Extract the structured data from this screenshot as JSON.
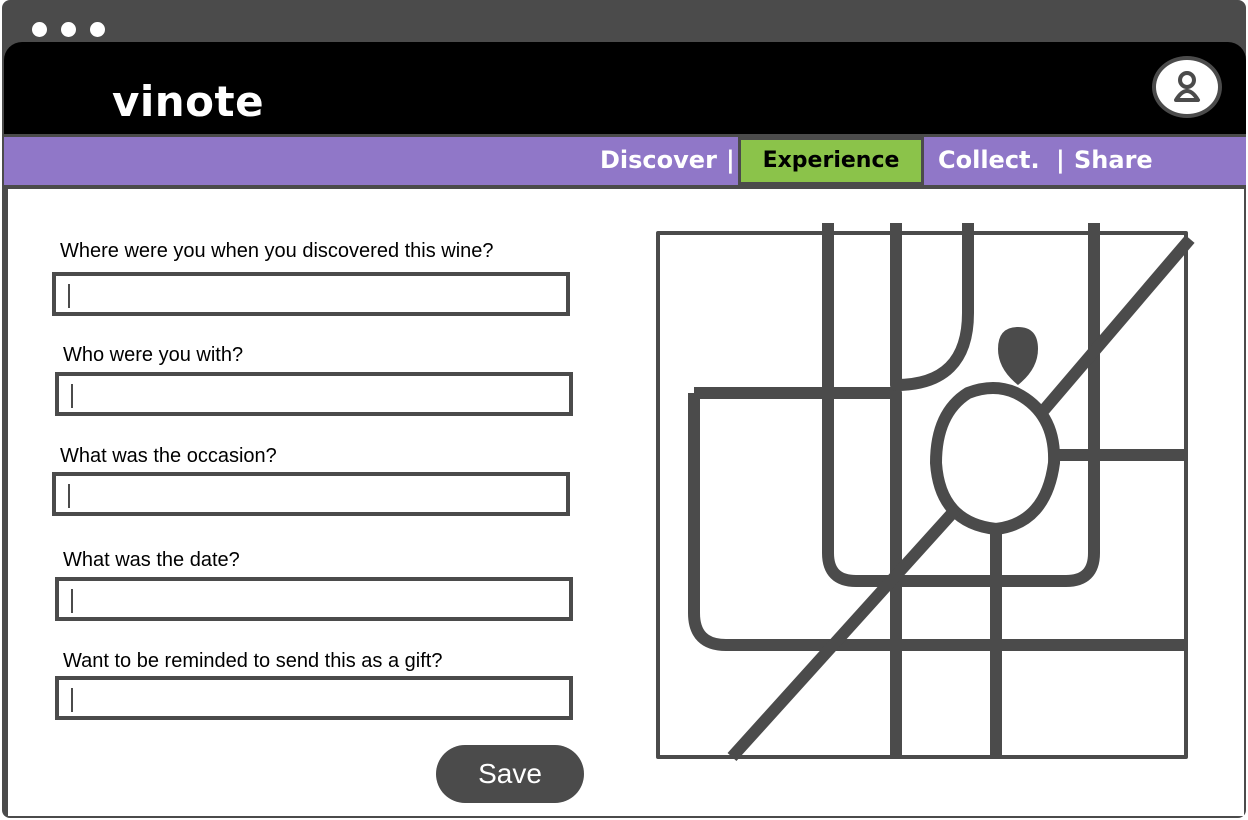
{
  "app": {
    "logo": "vinote"
  },
  "nav": {
    "items": [
      {
        "label": "Discover",
        "sep": "|"
      },
      {
        "label": "Experience",
        "active": true
      },
      {
        "label": "Collect.",
        "sep": "|"
      },
      {
        "label": "Share"
      }
    ]
  },
  "form": {
    "questions": [
      {
        "label": "Where were you when you discovered this wine?",
        "value": ""
      },
      {
        "label": "Who were you with?",
        "value": ""
      },
      {
        "label": "What was the occasion?",
        "value": ""
      },
      {
        "label": "What was the date?",
        "value": ""
      },
      {
        "label": "Want to be reminded to send this as a gift?",
        "value": ""
      }
    ],
    "save_label": "Save"
  },
  "icons": {
    "avatar": "user-icon",
    "map": "map-icon",
    "pin": "location-pin-icon"
  },
  "colors": {
    "nav_bg": "#9077c8",
    "nav_active": "#8bc34a",
    "chrome": "#4b4b4b"
  }
}
